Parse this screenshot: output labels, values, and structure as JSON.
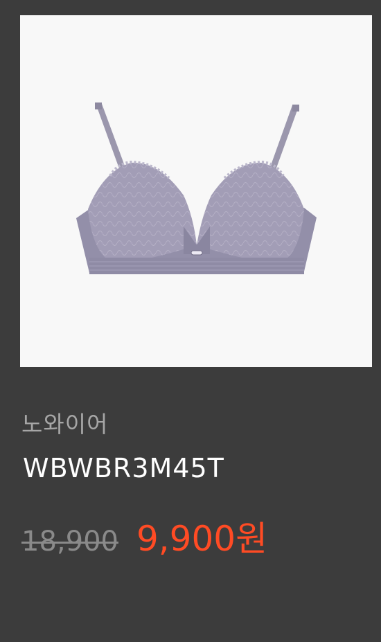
{
  "product": {
    "image_icon": "bra-product-photo",
    "image_color": "#8f8aa4",
    "brand": "노와이어",
    "model": "WBWBR3M45T",
    "original_price": "18,900",
    "sale_price": "9,900원",
    "colors": {
      "background": "#3c3c3c",
      "image_bg": "#f8f8f8",
      "brand_text": "#a6a6a6",
      "model_text": "#ffffff",
      "original_price": "#8a8a8a",
      "sale_price": "#ff4b24"
    }
  }
}
